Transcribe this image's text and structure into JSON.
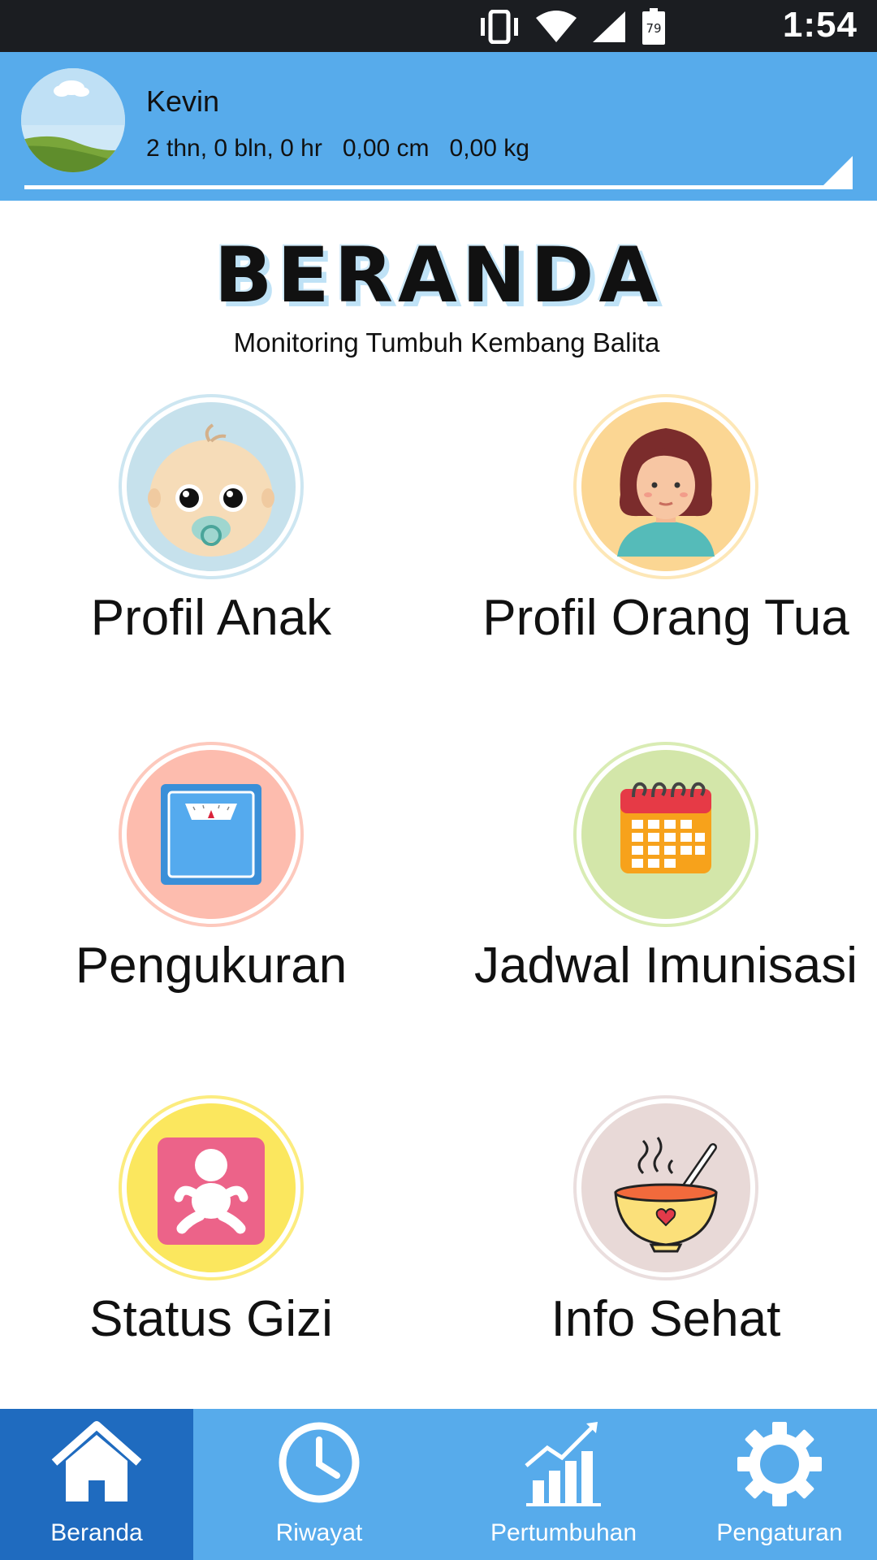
{
  "status_bar": {
    "time": "1:54",
    "battery_level": "79"
  },
  "profile": {
    "name": "Kevin",
    "stats": "2 thn, 0 bln, 0 hr   0,00 cm   0,00 kg"
  },
  "header": {
    "title": "BERANDA",
    "subtitle": "Monitoring Tumbuh Kembang Balita"
  },
  "menu": [
    {
      "label": "Profil Anak",
      "icon": "baby-face-icon",
      "circle_color": "#c6e1ec",
      "ring_color": "#cde6f1"
    },
    {
      "label": "Profil Orang Tua",
      "icon": "mother-icon",
      "circle_color": "#fbd693",
      "ring_color": "#fde7b7"
    },
    {
      "label": "Pengukuran",
      "icon": "scale-icon",
      "circle_color": "#fdbcae",
      "ring_color": "#fdc9bd"
    },
    {
      "label": "Jadwal Imunisasi",
      "icon": "calendar-icon",
      "circle_color": "#d3e6a9",
      "ring_color": "#d9ecb4"
    },
    {
      "label": "Status Gizi",
      "icon": "baby-status-icon",
      "circle_color": "#fbe75e",
      "ring_color": "#fcec7f"
    },
    {
      "label": "Info Sehat",
      "icon": "soup-bowl-icon",
      "circle_color": "#e8d9d7",
      "ring_color": "#eadede"
    }
  ],
  "bottom_nav": [
    {
      "label": "Beranda",
      "icon": "home-icon",
      "active": true
    },
    {
      "label": "Riwayat",
      "icon": "clock-icon",
      "active": false
    },
    {
      "label": "Pertumbuhan",
      "icon": "growth-chart-icon",
      "active": false
    },
    {
      "label": "Pengaturan",
      "icon": "gear-icon",
      "active": false
    }
  ],
  "colors": {
    "accent": "#57abeb",
    "nav_active": "#1f6bbf",
    "status_bar": "#1b1d21"
  }
}
